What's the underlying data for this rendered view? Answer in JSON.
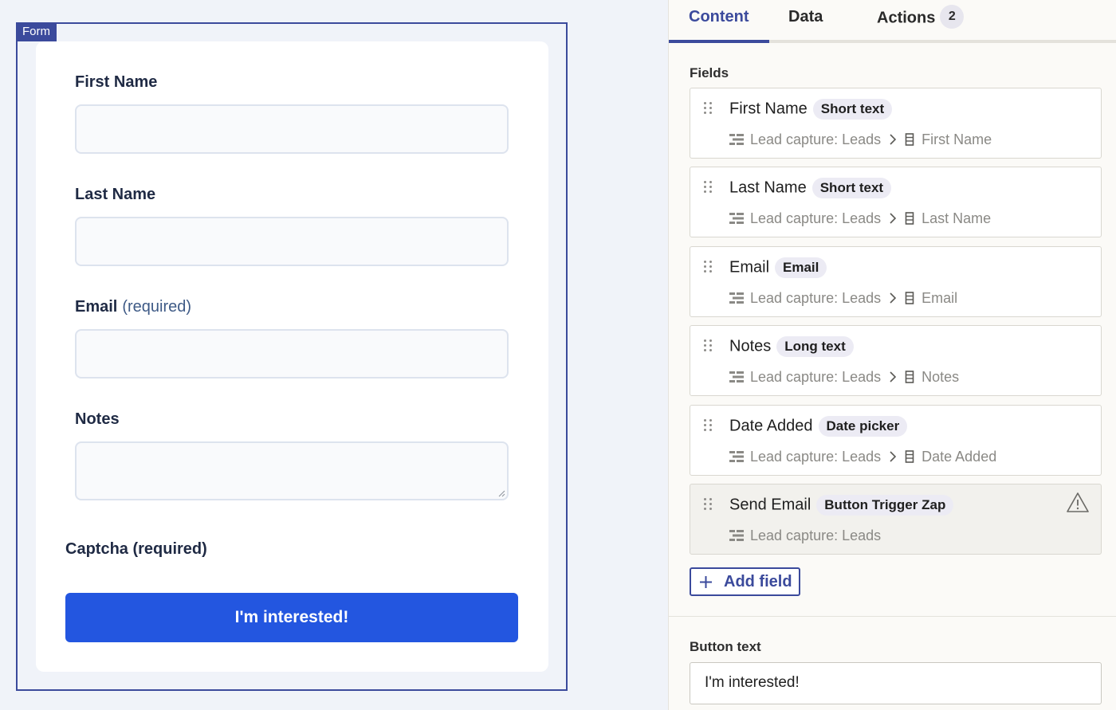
{
  "form": {
    "tag": "Form",
    "fields": [
      {
        "label": "First Name",
        "required_text": ""
      },
      {
        "label": "Last Name",
        "required_text": ""
      },
      {
        "label": "Email",
        "required_text": "(required)"
      },
      {
        "label": "Notes",
        "required_text": ""
      }
    ],
    "captcha_label": "Captcha (required)",
    "submit_label": "I'm interested!"
  },
  "panel": {
    "tabs": [
      {
        "label": "Content",
        "active": true
      },
      {
        "label": "Data",
        "active": false
      },
      {
        "label": "Actions",
        "badge": "2",
        "active": false
      }
    ],
    "fields_heading": "Fields",
    "field_list": [
      {
        "name": "First Name",
        "type": "Short text",
        "table": "Lead capture: Leads",
        "column": "First Name",
        "warning": false
      },
      {
        "name": "Last Name",
        "type": "Short text",
        "table": "Lead capture: Leads",
        "column": "Last Name",
        "warning": false
      },
      {
        "name": "Email",
        "type": "Email",
        "table": "Lead capture: Leads",
        "column": "Email",
        "warning": false
      },
      {
        "name": "Notes",
        "type": "Long text",
        "table": "Lead capture: Leads",
        "column": "Notes",
        "warning": false
      },
      {
        "name": "Date Added",
        "type": "Date picker",
        "table": "Lead capture: Leads",
        "column": "Date Added",
        "warning": false
      },
      {
        "name": "Send Email",
        "type": "Button Trigger Zap",
        "table": "Lead capture: Leads",
        "column": "",
        "warning": true
      }
    ],
    "add_field_label": "Add field",
    "button_text_heading": "Button text",
    "button_text_value": "I'm interested!"
  },
  "icons": {
    "drag": "drag-handle-icon",
    "table": "table-icon",
    "chevron": "chevron-right-icon",
    "column": "column-icon",
    "warning": "warning-triangle-icon",
    "plus": "plus-icon"
  },
  "colors": {
    "accent": "#3b4a9c",
    "primary_button": "#2356e0",
    "canvas_bg": "#f0f3f9",
    "panel_bg": "#fbfaf7"
  }
}
